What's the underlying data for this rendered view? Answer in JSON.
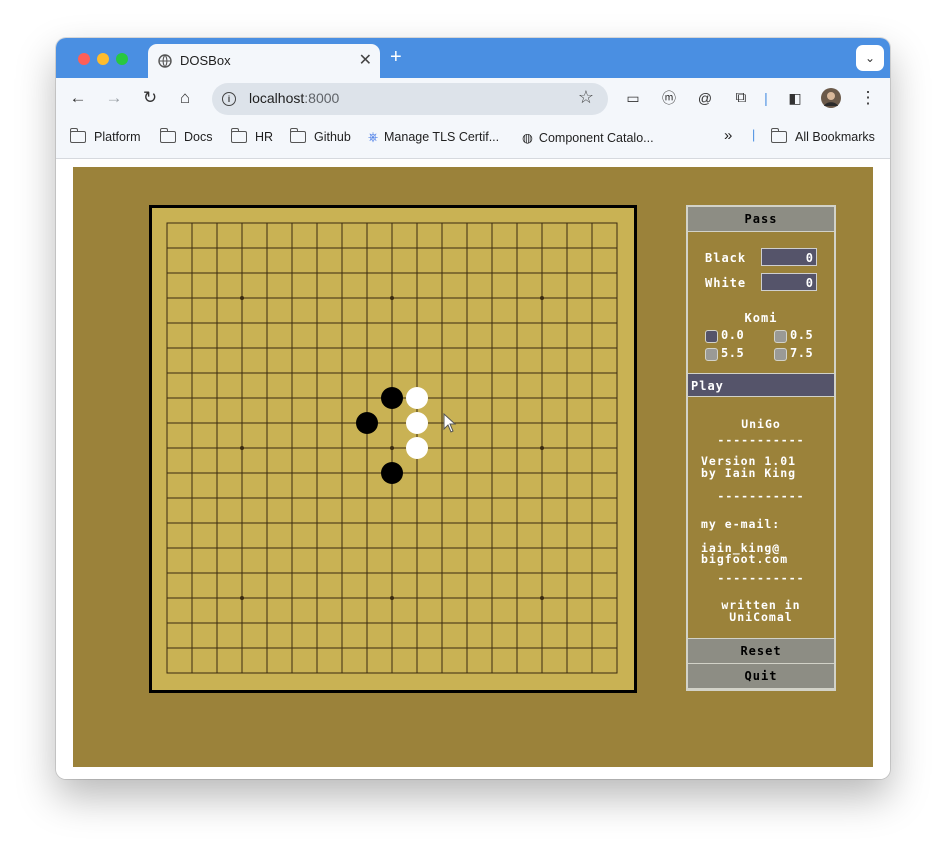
{
  "browser": {
    "tab_title": "DOSBox",
    "url_host": "localhost",
    "url_port": ":8000",
    "bookmarks": [
      "Platform",
      "Docs",
      "HR",
      "Github",
      "Manage TLS Certif...",
      "Component Catalo..."
    ],
    "more_bookmarks": "»",
    "all_bookmarks": "All Bookmarks"
  },
  "board": {
    "size": 19,
    "star_points": [
      [
        3,
        3
      ],
      [
        3,
        9
      ],
      [
        3,
        15
      ],
      [
        9,
        3
      ],
      [
        9,
        9
      ],
      [
        9,
        15
      ],
      [
        15,
        3
      ],
      [
        15,
        9
      ],
      [
        15,
        15
      ]
    ],
    "black_stones": [
      [
        9,
        7
      ],
      [
        8,
        8
      ],
      [
        9,
        10
      ]
    ],
    "white_stones": [
      [
        10,
        7
      ],
      [
        10,
        8
      ],
      [
        10,
        9
      ]
    ],
    "colors": {
      "board": "#c9b254",
      "line": "#3a2a10",
      "black": "#000000",
      "white": "#ffffff",
      "background": "#9b823a"
    }
  },
  "panel": {
    "pass_label": "Pass",
    "black_label": "Black",
    "black_score": "0",
    "white_label": "White",
    "white_score": "0",
    "komi_title": "Komi",
    "komi_options": [
      "0.0",
      "0.5",
      "5.5",
      "7.5"
    ],
    "komi_selected": "0.0",
    "status": "Play",
    "app_name": "UniGo",
    "separator": "-----------",
    "version_line1": "Version 1.01",
    "version_line2": "by Iain King",
    "email_label": "my e-mail:",
    "email_line1": "iain_king@",
    "email_line2": "bigfoot.com",
    "written_line1": "written in",
    "written_line2": "UniComal",
    "reset_label": "Reset",
    "quit_label": "Quit"
  }
}
